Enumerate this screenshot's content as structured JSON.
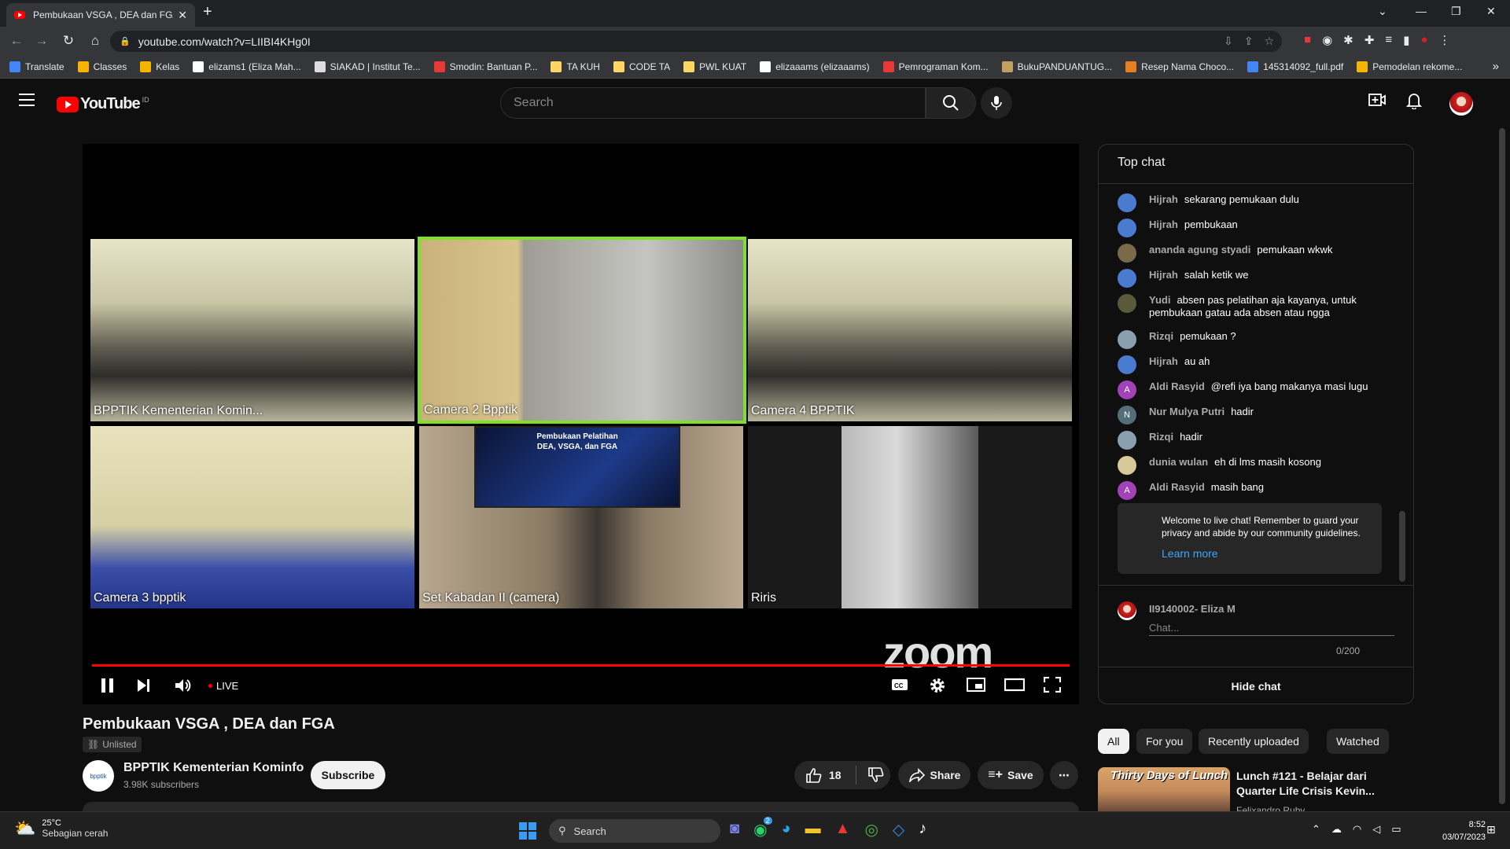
{
  "browser": {
    "tab_title": "Pembukaan VSGA , DEA dan FGA",
    "url": "youtube.com/watch?v=LIIBI4KHg0I",
    "bookmarks": [
      {
        "label": "Translate",
        "color": "#4285f4"
      },
      {
        "label": "Classes",
        "color": "#f4b400"
      },
      {
        "label": "Kelas",
        "color": "#f4b400"
      },
      {
        "label": "elizams1 (Eliza Mah...",
        "color": "#ffffff"
      },
      {
        "label": "SIAKAD | Institut Te...",
        "color": "#dddddd"
      },
      {
        "label": "Smodin: Bantuan P...",
        "color": "#e53935"
      },
      {
        "label": "TA KUH",
        "color": "#fdd663"
      },
      {
        "label": "CODE TA",
        "color": "#fdd663"
      },
      {
        "label": "PWL KUAT",
        "color": "#fdd663"
      },
      {
        "label": "elizaaams (elizaaams)",
        "color": "#ffffff"
      },
      {
        "label": "Pemrograman Kom...",
        "color": "#e53935"
      },
      {
        "label": "BukuPANDUANTUG...",
        "color": "#c0a060"
      },
      {
        "label": "Resep Nama Choco...",
        "color": "#e67e22"
      },
      {
        "label": "145314092_full.pdf",
        "color": "#4285f4"
      },
      {
        "label": "Pemodelan rekome...",
        "color": "#f4b400"
      }
    ]
  },
  "youtube": {
    "logo_text": "YouTube",
    "logo_country": "ID",
    "search_placeholder": "Search"
  },
  "player": {
    "tiles": [
      {
        "label": "BPPTIK Kementerian Komin...",
        "bg": "#8e8c74",
        "active": false
      },
      {
        "label": "Camera 2 Bpptik",
        "bg": "#9a8a6a",
        "active": true
      },
      {
        "label": "Camera 4 BPPTIK",
        "bg": "#8f8c78",
        "active": false
      },
      {
        "label": "Camera 3 bpptik",
        "bg": "#b8b291",
        "active": false
      },
      {
        "label": "Set Kabadan II (camera)",
        "bg": "#6a5a4c",
        "active": false
      },
      {
        "label": "Riris",
        "bg": "#1a1a1a",
        "active": false
      }
    ],
    "slide_text": [
      "Pembukaan Pelatihan",
      "DEA, VSGA, dan FGA"
    ],
    "live_label": "LIVE",
    "watermark": "zoom",
    "active_border_color": "#7fe02b"
  },
  "video": {
    "title": "Pembukaan VSGA , DEA dan FGA",
    "visibility": "Unlisted",
    "channel_name": "BPPTIK Kementerian Kominfo",
    "subscribers": "3.98K subscribers",
    "channel_avatar_text": "bpptik",
    "subscribe_label": "Subscribe",
    "likes": "18",
    "share_label": "Share",
    "save_label": "Save"
  },
  "chat": {
    "header": "Top chat",
    "messages": [
      {
        "name": "Hijrah",
        "text": "sekarang pemukaan dulu",
        "avatar": "#4a7bd0",
        "initial": ""
      },
      {
        "name": "Hijrah",
        "text": "pembukaan",
        "avatar": "#4a7bd0",
        "initial": ""
      },
      {
        "name": "ananda agung styadi",
        "text": "pemukaan wkwk",
        "avatar": "#7a6a4a",
        "initial": ""
      },
      {
        "name": "Hijrah",
        "text": "salah ketik we",
        "avatar": "#4a7bd0",
        "initial": ""
      },
      {
        "name": "Yudi",
        "text": "absen pas pelatihan aja kayanya, untuk pembukaan gatau ada absen atau ngga",
        "avatar": "#5a5a3a",
        "initial": ""
      },
      {
        "name": "Rizqi",
        "text": "pemukaan ?",
        "avatar": "#8aa0b0",
        "initial": ""
      },
      {
        "name": "Hijrah",
        "text": "au ah",
        "avatar": "#4a7bd0",
        "initial": ""
      },
      {
        "name": "Aldi Rasyid",
        "text": "@refi iya bang makanya masi lugu",
        "avatar": "#a142b8",
        "initial": "A"
      },
      {
        "name": "Nur Mulya Putri",
        "text": "hadir",
        "avatar": "#546e7a",
        "initial": "N"
      },
      {
        "name": "Rizqi",
        "text": "hadir",
        "avatar": "#8aa0b0",
        "initial": ""
      },
      {
        "name": "dunia wulan",
        "text": "eh di lms masih kosong",
        "avatar": "#d8c89a",
        "initial": ""
      },
      {
        "name": "Aldi Rasyid",
        "text": "masih bang",
        "avatar": "#a142b8",
        "initial": "A"
      }
    ],
    "welcome_text": "Welcome to live chat! Remember to guard your privacy and abide by our community guidelines.",
    "learn_more": "Learn more",
    "user_name": "II9140002- Eliza M",
    "input_placeholder": "Chat...",
    "char_count": "0/200",
    "hide_chat": "Hide chat"
  },
  "recommendations": {
    "chips": [
      "All",
      "For you",
      "Recently uploaded",
      "Watched"
    ],
    "first_title": "Lunch #121 - Belajar dari Quarter Life Crisis Kevin...",
    "first_channel": "Felixandro Ruby",
    "thumb_text": "Thirty Days of Lunch"
  },
  "taskbar": {
    "temp": "25°C",
    "weather": "Sebagian cerah",
    "search": "Search",
    "whatsapp_badge": "2",
    "time": "8:52",
    "date": "03/07/2023"
  }
}
